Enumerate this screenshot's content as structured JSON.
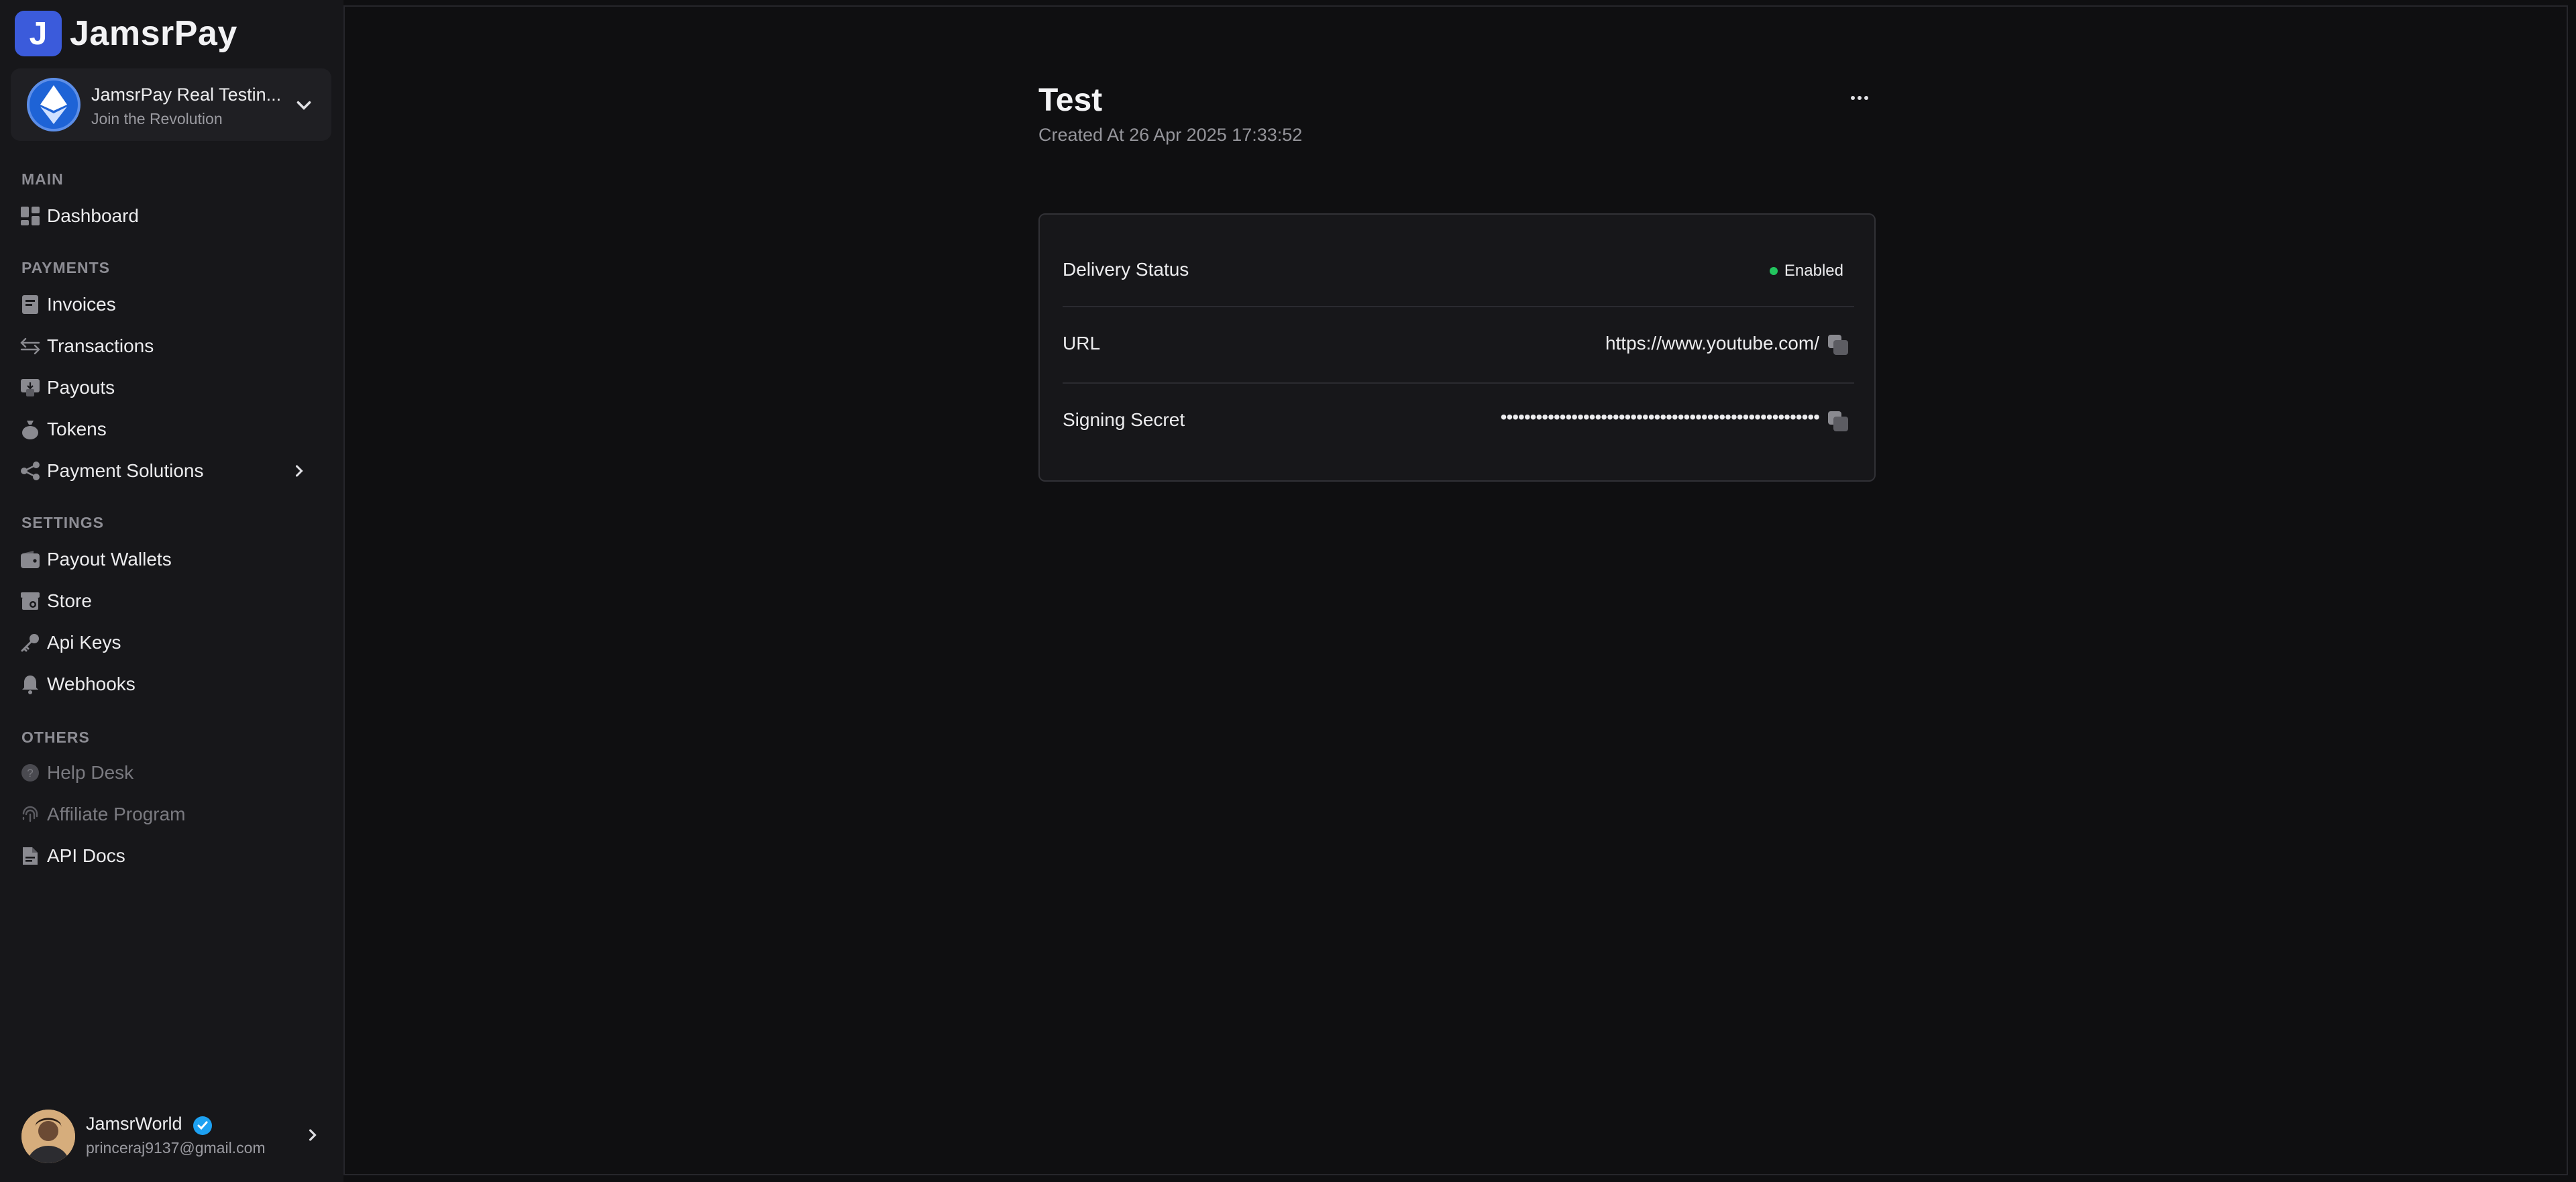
{
  "brand": {
    "logo_letter": "J",
    "name": "JamsrPay"
  },
  "project": {
    "name": "JamsrPay Real Testin...",
    "subtitle": "Join the Revolution"
  },
  "sections": {
    "main": "MAIN",
    "payments": "PAYMENTS",
    "settings": "SETTINGS",
    "others": "OTHERS"
  },
  "nav": {
    "dashboard": "Dashboard",
    "invoices": "Invoices",
    "transactions": "Transactions",
    "payouts": "Payouts",
    "tokens": "Tokens",
    "payment_solutions": "Payment Solutions",
    "payout_wallets": "Payout Wallets",
    "store": "Store",
    "api_keys": "Api Keys",
    "webhooks": "Webhooks",
    "help_desk": "Help Desk",
    "affiliate_program": "Affiliate Program",
    "api_docs": "API Docs"
  },
  "user": {
    "name": "JamsrWorld",
    "email": "princeraj9137@gmail.com"
  },
  "webhook": {
    "title": "Test",
    "created": "Created At 26 Apr 2025 17:33:52",
    "rows": {
      "delivery_label": "Delivery Status",
      "delivery_value": "Enabled",
      "url_label": "URL",
      "url_value": "https://www.youtube.com/",
      "secret_label": "Signing Secret",
      "secret_value": "••••••••••••••••••••••••••••••••••••••••••••••••••••••"
    }
  },
  "colors": {
    "accent": "#3b5bdb",
    "status_enabled": "#22c55e",
    "verified": "#1da1f2"
  }
}
